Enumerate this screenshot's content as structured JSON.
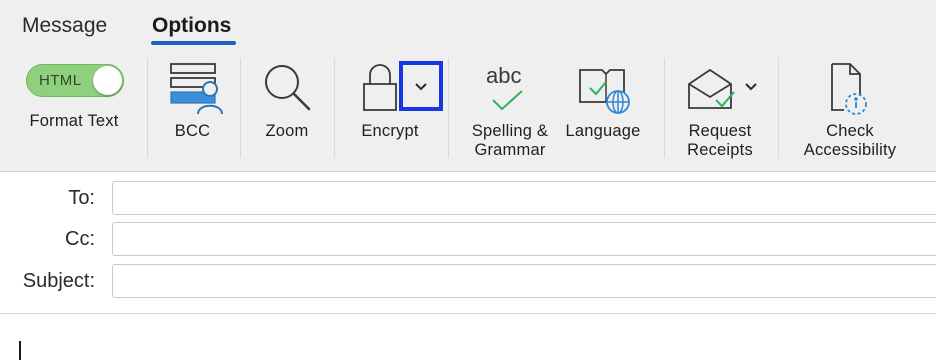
{
  "tabs": [
    {
      "label": "Message",
      "selected": false
    },
    {
      "label": "Options",
      "selected": true
    }
  ],
  "ribbon": {
    "format_text": {
      "toggle_label": "HTML",
      "label": "Format Text",
      "on": true
    },
    "bcc": {
      "label": "BCC"
    },
    "zoom": {
      "label": "Zoom"
    },
    "encrypt": {
      "label": "Encrypt",
      "dropdown_icon": "chevron-down-icon"
    },
    "spelling": {
      "icon_text": "abc",
      "label_line1": "Spelling &",
      "label_line2": "Grammar"
    },
    "language": {
      "label": "Language"
    },
    "request_receipts": {
      "label_line1": "Request",
      "label_line2": "Receipts"
    },
    "check_accessibility": {
      "label_line1": "Check",
      "label_line2": "Accessibility"
    }
  },
  "fields": {
    "to": {
      "label": "To:",
      "value": ""
    },
    "cc": {
      "label": "Cc:",
      "value": ""
    },
    "subject": {
      "label": "Subject:",
      "value": ""
    }
  },
  "colors": {
    "accent_blue": "#1e62c8",
    "toggle_green": "#8ed07d",
    "check_green": "#2fb35a",
    "highlight_blue": "#1a35e6",
    "icon_blue": "#2f86d8"
  }
}
